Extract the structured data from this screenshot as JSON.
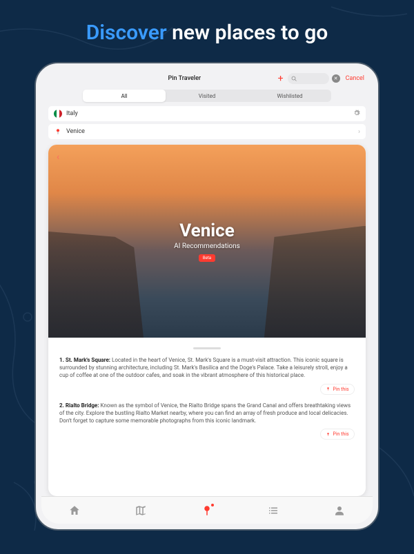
{
  "marketing": {
    "headline_accent": "Discover",
    "headline_rest": " new places to go"
  },
  "topbar": {
    "title": "Pin Traveler",
    "cancel": "Cancel"
  },
  "segments": {
    "all": "All",
    "visited": "Visited",
    "wishlist": "Wishlisted"
  },
  "breadcrumb": {
    "country": "Italy",
    "city": "Venice"
  },
  "hero": {
    "title": "Venice",
    "subtitle": "AI Recommendations",
    "badge": "Beta"
  },
  "recommendations": [
    {
      "num": "1.",
      "title": "St. Mark's Square:",
      "body": "Located in the heart of Venice, St. Mark's Square is a must-visit attraction. This iconic square is surrounded by stunning architecture, including St. Mark's Basilica and the Doge's Palace. Take a leisurely stroll, enjoy a cup of coffee at one of the outdoor cafes, and soak in the vibrant atmosphere of this historical place."
    },
    {
      "num": "2.",
      "title": "Rialto Bridge:",
      "body": "Known as the symbol of Venice, the Rialto Bridge spans the Grand Canal and offers breathtaking views of the city. Explore the bustling Rialto Market nearby, where you can find an array of fresh produce and local delicacies. Don't forget to capture some memorable photographs from this iconic landmark."
    }
  ],
  "buttons": {
    "pin_this": "Pin this"
  }
}
